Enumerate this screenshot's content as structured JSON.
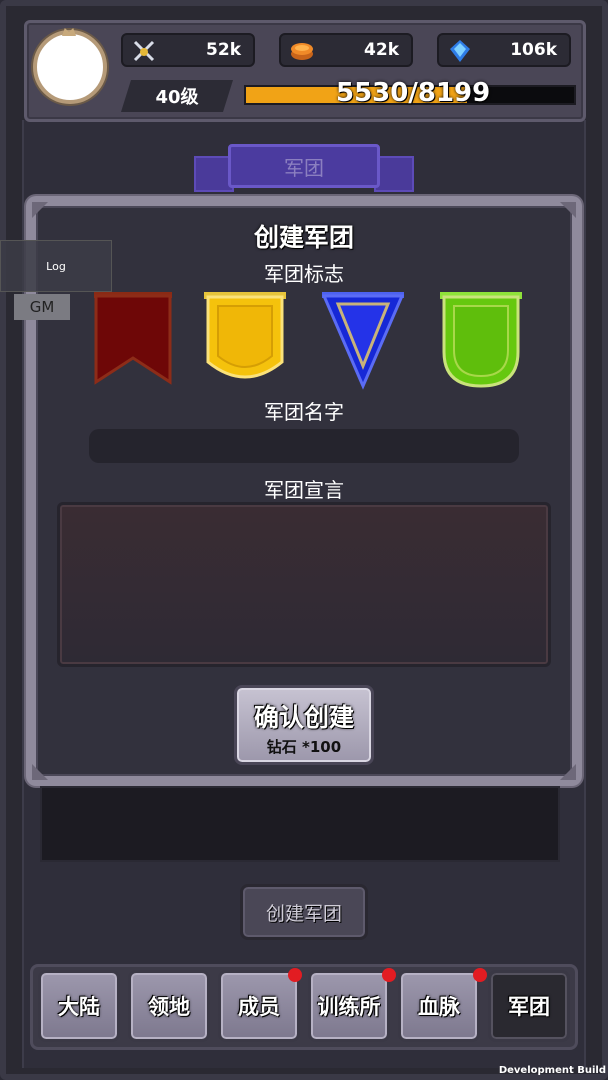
{
  "header": {
    "resources": [
      {
        "icon": "crossed-swords-icon",
        "value": "52k"
      },
      {
        "icon": "gold-coin-icon",
        "value": "42k"
      },
      {
        "icon": "diamond-icon",
        "value": "106k"
      }
    ],
    "level": "40级",
    "xp_text": "5530/8199",
    "xp_current": 5530,
    "xp_max": 8199
  },
  "banner": {
    "title": "军团"
  },
  "dialog": {
    "title": "创建军团",
    "emblem_label": "军团标志",
    "emblems": [
      {
        "name": "dark-red-banner",
        "color": "#7a0a0a"
      },
      {
        "name": "gold-shield",
        "color": "#f4c20d"
      },
      {
        "name": "blue-triangle",
        "color": "#1b2de0"
      },
      {
        "name": "green-shield",
        "color": "#6ccf12"
      }
    ],
    "name_label": "军团名字",
    "name_value": "",
    "declaration_label": "军团宣言",
    "declaration_value": "",
    "confirm_label": "确认创建",
    "confirm_cost": "钻石 *100"
  },
  "create_button": "创建军团",
  "nav": [
    {
      "label": "大陆",
      "badge": false,
      "active": false
    },
    {
      "label": "领地",
      "badge": false,
      "active": false
    },
    {
      "label": "成员",
      "badge": true,
      "active": false
    },
    {
      "label": "训练所",
      "badge": true,
      "active": false
    },
    {
      "label": "血脉",
      "badge": true,
      "active": false
    },
    {
      "label": "军团",
      "badge": false,
      "active": true
    }
  ],
  "debug": {
    "log": "Log",
    "gm": "GM",
    "build": "Development Build"
  }
}
